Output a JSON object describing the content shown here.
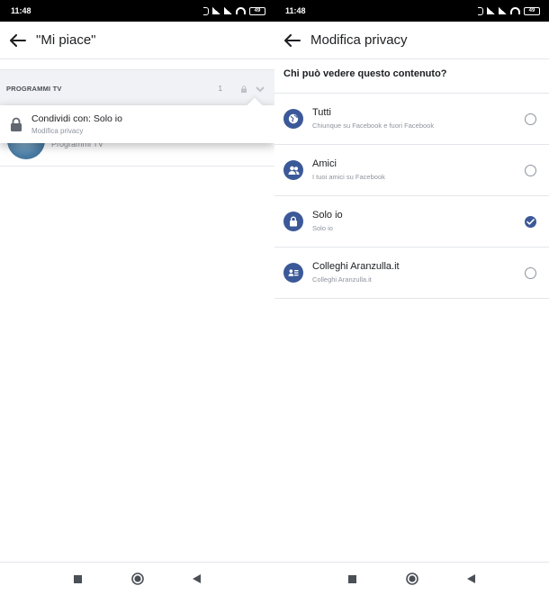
{
  "left": {
    "status": {
      "time": "11:48",
      "battery": "49"
    },
    "title": "\"Mi piace\"",
    "section": {
      "title": "PROGRAMMI TV",
      "count": "1"
    },
    "row": {
      "subtitle": "Programmi TV"
    },
    "popup": {
      "title": "Condividi con: Solo io",
      "subtitle": "Modifica privacy"
    }
  },
  "right": {
    "status": {
      "time": "11:48",
      "battery": "49"
    },
    "title": "Modifica privacy",
    "question": "Chi può vedere questo contenuto?",
    "options": [
      {
        "icon": "globe-icon",
        "title": "Tutti",
        "subtitle": "Chiunque su Facebook e fuori Facebook",
        "selected": false
      },
      {
        "icon": "friends-icon",
        "title": "Amici",
        "subtitle": "I tuoi amici su Facebook",
        "selected": false
      },
      {
        "icon": "lock-icon",
        "title": "Solo io",
        "subtitle": "Solo io",
        "selected": true
      },
      {
        "icon": "contact-card-icon",
        "title": "Colleghi Aranzulla.it",
        "subtitle": "Colleghi Aranzulla.it",
        "selected": false
      }
    ]
  },
  "colors": {
    "accent": "#3b5998",
    "divider": "#e4e6eb",
    "section_bg": "#f0f2f5"
  }
}
